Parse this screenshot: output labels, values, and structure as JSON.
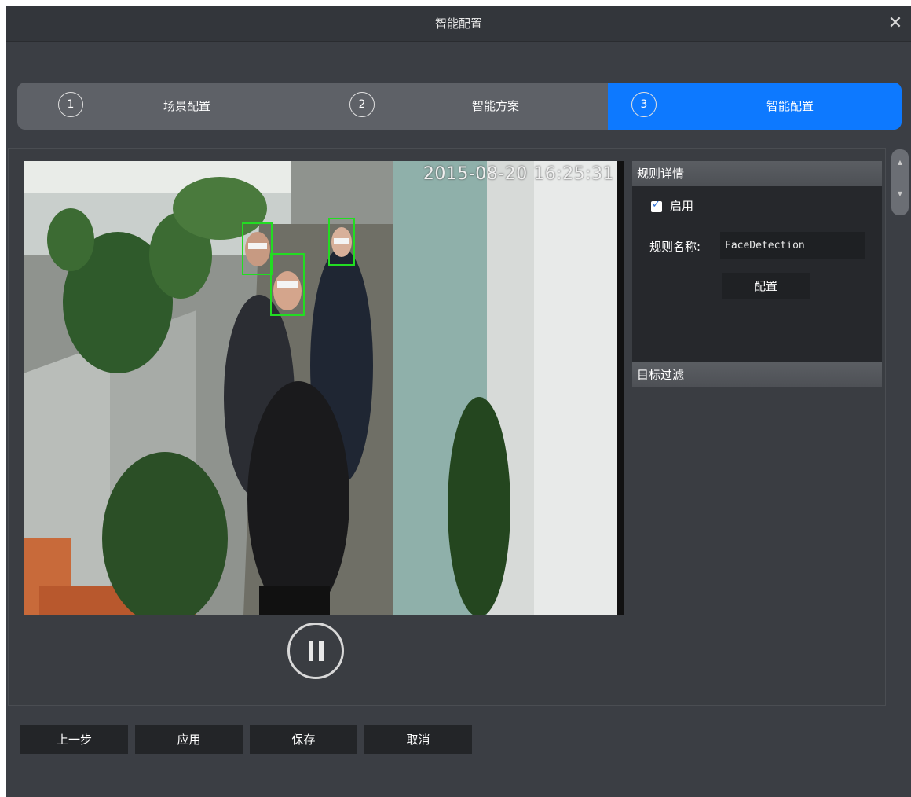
{
  "dialog": {
    "title": "智能配置",
    "close_glyph": "✕"
  },
  "stepper": {
    "steps": [
      {
        "number": "1",
        "label": "场景配置",
        "active": false
      },
      {
        "number": "2",
        "label": "智能方案",
        "active": false
      },
      {
        "number": "3",
        "label": "智能配置",
        "active": true
      }
    ],
    "active_color": "#0d79ff"
  },
  "video": {
    "timestamp": "2015-08-20 16:25:31",
    "detection_box_color": "#22dd22",
    "play_state_icon": "pause-icon"
  },
  "rule_details": {
    "header": "规则详情",
    "enable_label": "启用",
    "enabled": true,
    "rule_name_label": "规则名称:",
    "rule_name_value": "FaceDetection",
    "config_button": "配置"
  },
  "target_filter": {
    "header": "目标过滤"
  },
  "footer": {
    "prev_label": "上一步",
    "apply_label": "应用",
    "save_label": "保存",
    "cancel_label": "取消"
  }
}
